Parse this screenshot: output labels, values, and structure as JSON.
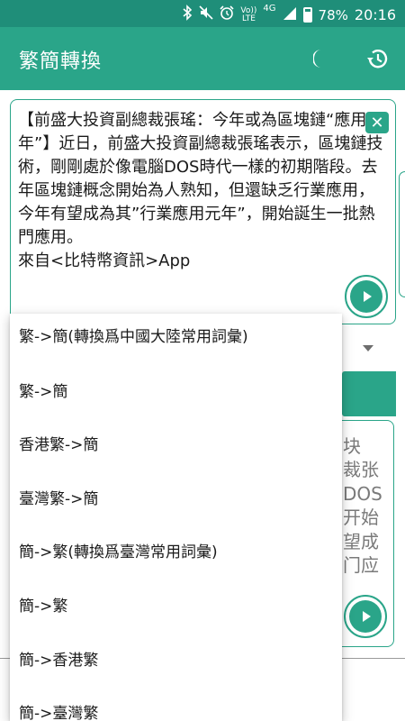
{
  "status_bar": {
    "icons": [
      "bluetooth-icon",
      "mute-icon",
      "alarm-icon",
      "volte-icon",
      "4g-icon",
      "signal-icon",
      "battery-icon"
    ],
    "volte_top": "Vo))",
    "volte_bottom": "LTE",
    "network": "4G",
    "battery_percent": "78%",
    "battery_level": 0.78,
    "time": "20:16"
  },
  "app_bar": {
    "title": "繁簡轉換",
    "actions": [
      "night-mode-icon",
      "history-icon"
    ]
  },
  "input": {
    "text": "【前盛大投資副總裁張瑤：今年或為區塊鏈“應用元年”】近日，前盛大投資副總裁張瑤表示，區塊鏈技術，剛剛處於像電腦DOS時代一樣的初期階段。去年區塊鏈概念開始為人熟知，但還缺乏行業應用，今年有望成為其”行業應用元年”，開始誕生一批熱門應用。\n來自<比特幣資訊>App",
    "clear_symbol": "✕"
  },
  "output_partial": {
    "lines": [
      "块",
      "裁张",
      "DOS",
      "开始",
      "望成",
      "门应"
    ]
  },
  "dropdown": {
    "options": [
      "繁->簡(轉換爲中國大陸常用詞彙)",
      "繁->簡",
      "香港繁->簡",
      "臺灣繁->簡",
      "簡->繁(轉換爲臺灣常用詞彙)",
      "簡->繁",
      "簡->香港繁",
      "簡->臺灣繁"
    ]
  },
  "colors": {
    "status_bar": "#1f8e79",
    "app_bar": "#2aa589",
    "accent": "#2aa589"
  }
}
